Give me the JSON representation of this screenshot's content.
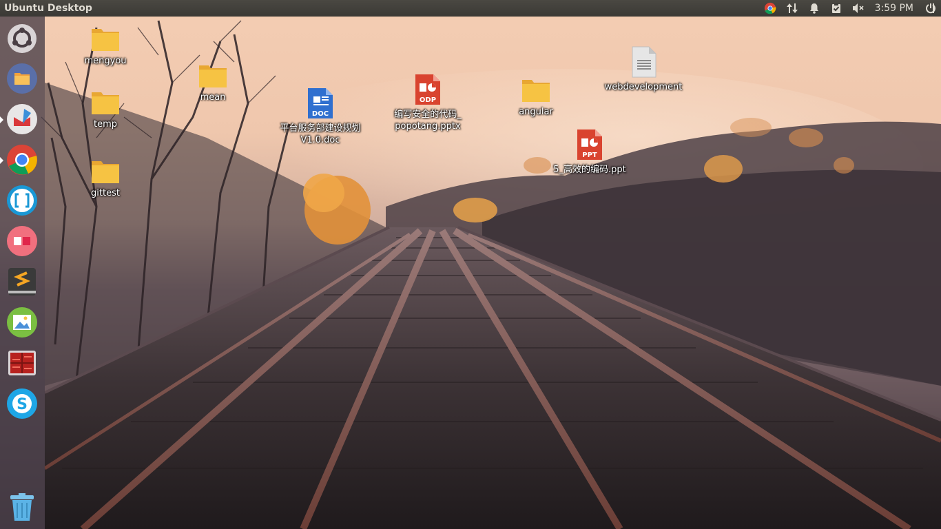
{
  "panel": {
    "title": "Ubuntu Desktop",
    "clock": "3:59 PM",
    "tray_icons": [
      "chrome-icon",
      "network-transfer-icon",
      "notification-bell-icon",
      "clipboard-check-icon",
      "speaker-muted-icon",
      "power-settings-icon"
    ]
  },
  "launcher": {
    "items": [
      "ubuntu-dash",
      "files",
      "mail",
      "google-chrome",
      "brackets",
      "presentation-app",
      "sublime-text",
      "image-viewer",
      "system-monitor",
      "skype",
      "trash"
    ]
  },
  "desktop": {
    "icons": {
      "mengyou": "mengyou",
      "mean": "mean",
      "temp": "temp",
      "gittest": "gittest",
      "doc_line1": "平台服务部建设规划",
      "doc_line2": "V1.0.doc",
      "odp_line1": "编写安全的代码_",
      "odp_line2": "popotang.pptx",
      "angular": "angular",
      "webdevelopment": "webdevelopment",
      "ppt": "5_高效的编码.ppt"
    },
    "badges": {
      "doc": "DOC",
      "odp": "ODP",
      "ppt": "PPT"
    }
  },
  "colors": {
    "panel": "#3c3b37",
    "folder": "#f6c343",
    "doc_blue": "#2f6fcf",
    "odp_red": "#d9432f"
  }
}
